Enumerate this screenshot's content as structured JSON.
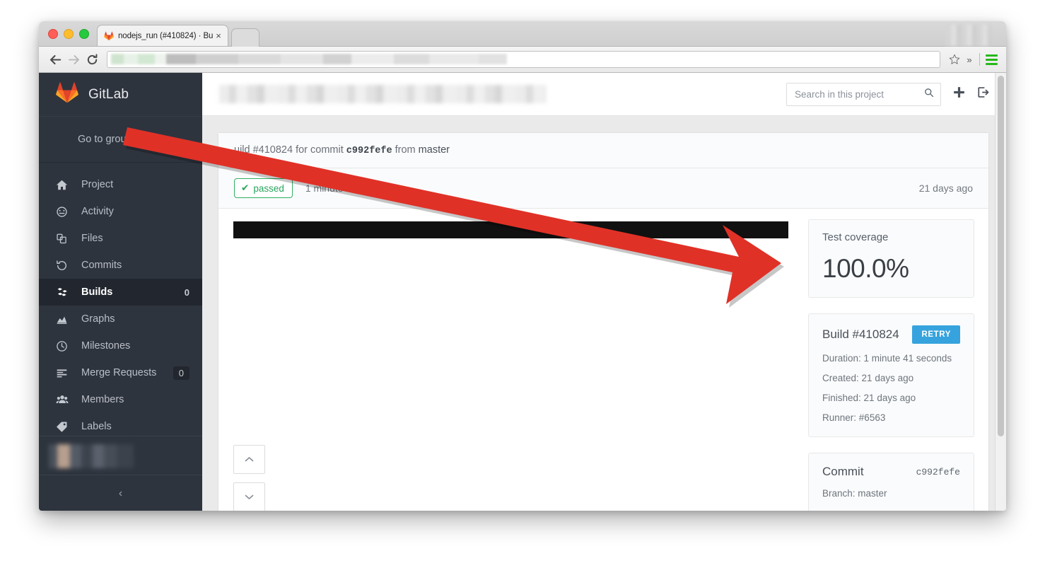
{
  "browser": {
    "tab": {
      "favicon": "gitlab-favicon",
      "title": "nodejs_run (#410824) · Bu",
      "close_label": "×"
    },
    "toolbar": {
      "back_label": "←",
      "forward_label": "→",
      "reload_label": "⟳",
      "bookmark_label": "☆",
      "overflow_label": "»",
      "menu_label": "menu"
    }
  },
  "sidebar": {
    "brand": "GitLab",
    "group_link": "Go to group",
    "items": [
      {
        "icon": "home-icon",
        "label": "Project",
        "count": ""
      },
      {
        "icon": "activity-icon",
        "label": "Activity",
        "count": ""
      },
      {
        "icon": "files-icon",
        "label": "Files",
        "count": ""
      },
      {
        "icon": "history-icon",
        "label": "Commits",
        "count": ""
      },
      {
        "icon": "builds-icon",
        "label": "Builds",
        "count": "0"
      },
      {
        "icon": "graphs-icon",
        "label": "Graphs",
        "count": ""
      },
      {
        "icon": "milestone-icon",
        "label": "Milestones",
        "count": ""
      },
      {
        "icon": "merge-request-icon",
        "label": "Merge Requests",
        "count": "0"
      },
      {
        "icon": "members-icon",
        "label": "Members",
        "count": ""
      },
      {
        "icon": "labels-icon",
        "label": "Labels",
        "count": ""
      }
    ],
    "active_index": 4,
    "collapse_label": "‹"
  },
  "topbar": {
    "search": {
      "placeholder": "Search in this project",
      "value": "",
      "icon": "search-icon"
    },
    "new_label": "+",
    "signout_label": "sign-out-icon"
  },
  "build": {
    "header_prefix": "uild",
    "header_number": "#410824",
    "header_for_commit": "for commit",
    "header_hash": "c992fefe",
    "header_from": "from",
    "header_branch": "master",
    "status": "passed",
    "status_check": "✔",
    "duration": "1 minute 41 seconds",
    "relative_time": "21 days ago",
    "scroll_up": "⌃",
    "scroll_down": "⌄"
  },
  "coverage": {
    "label": "Test coverage",
    "value": "100.0%"
  },
  "build_card": {
    "title": "Build #410824",
    "retry_label": "RETRY",
    "duration_label": "Duration:",
    "duration_value": "1 minute 41 seconds",
    "created_label": "Created:",
    "created_value": "21 days ago",
    "finished_label": "Finished:",
    "finished_value": "21 days ago",
    "runner_label": "Runner:",
    "runner_value": "#6563"
  },
  "commit_card": {
    "title": "Commit",
    "hash": "c992fefe",
    "branch_label": "Branch:",
    "branch_value": "master"
  },
  "colors": {
    "sidebar_bg": "#2e343e",
    "sidebar_active": "#22262e",
    "accent_blue": "#36a3de",
    "passed_green": "#2aa55d",
    "annotation_red": "#e03127"
  }
}
